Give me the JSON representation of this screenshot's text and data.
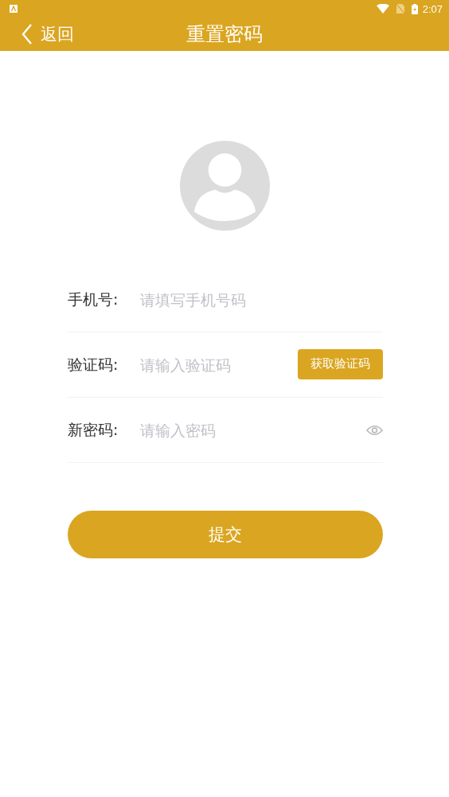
{
  "status_bar": {
    "time": "2:07"
  },
  "nav": {
    "back": "返回",
    "title": "重置密码"
  },
  "fields": [
    {
      "kind": "plain",
      "label": "手机号:",
      "placeholder": "请填写手机号码"
    },
    {
      "kind": "code",
      "label": "验证码:",
      "placeholder": "请输入验证码",
      "action": "获取验证码"
    },
    {
      "kind": "password",
      "label": "新密码:",
      "placeholder": "请输入密码"
    }
  ],
  "submit": "提交"
}
